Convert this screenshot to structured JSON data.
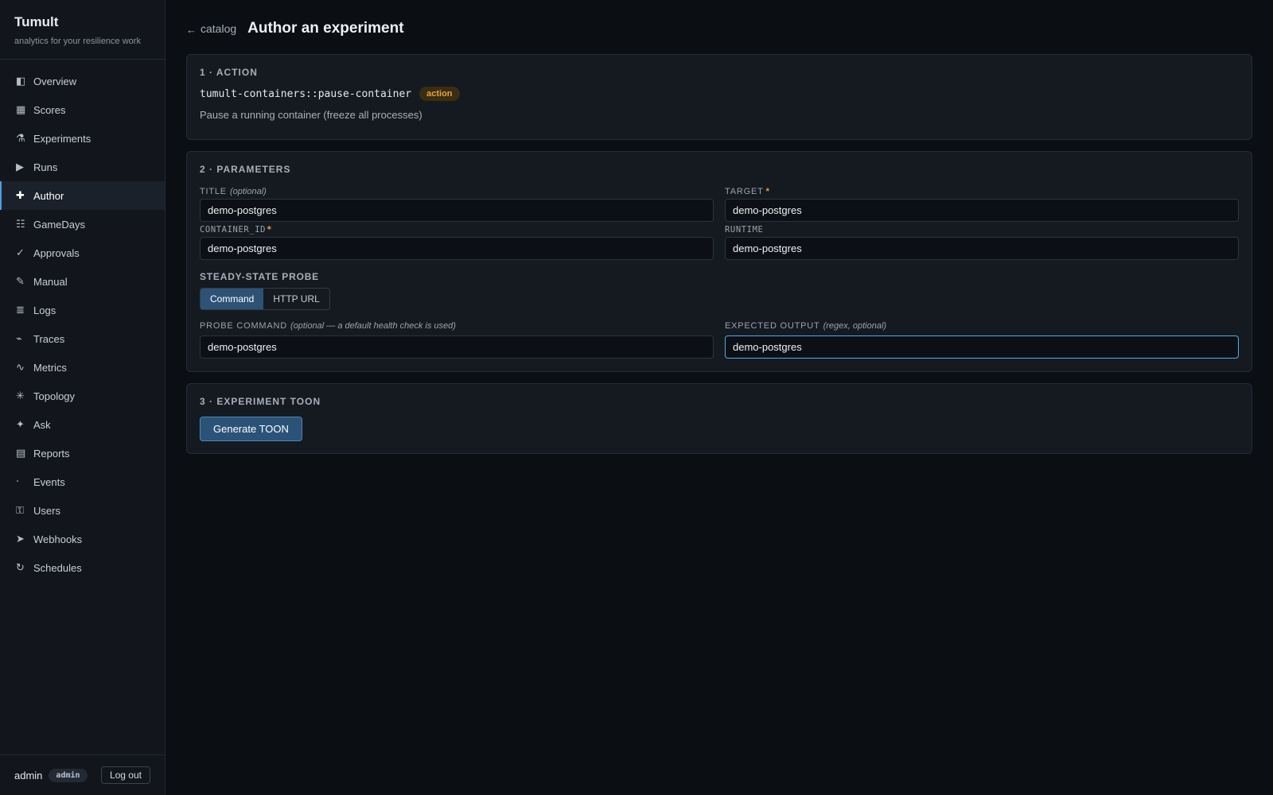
{
  "brand": {
    "title": "Tumult",
    "subtitle": "analytics for your resilience work"
  },
  "sidebar": {
    "items": [
      {
        "label": "Overview",
        "icon": "◧",
        "active": false
      },
      {
        "label": "Scores",
        "icon": "▦",
        "active": false
      },
      {
        "label": "Experiments",
        "icon": "⚗",
        "active": false
      },
      {
        "label": "Runs",
        "icon": "▶",
        "active": false
      },
      {
        "label": "Author",
        "icon": "✚",
        "active": true
      },
      {
        "label": "GameDays",
        "icon": "☷",
        "active": false
      },
      {
        "label": "Approvals",
        "icon": "✓",
        "active": false
      },
      {
        "label": "Manual",
        "icon": "✎",
        "active": false
      },
      {
        "label": "Logs",
        "icon": "≣",
        "active": false
      },
      {
        "label": "Traces",
        "icon": "⌁",
        "active": false
      },
      {
        "label": "Metrics",
        "icon": "∿",
        "active": false
      },
      {
        "label": "Topology",
        "icon": "✳",
        "active": false
      },
      {
        "label": "Ask",
        "icon": "✦",
        "active": false
      },
      {
        "label": "Reports",
        "icon": "▤",
        "active": false
      },
      {
        "label": "Events",
        "icon": "‧",
        "active": false
      },
      {
        "label": "Users",
        "icon": "⚿",
        "active": false
      },
      {
        "label": "Webhooks",
        "icon": "➤",
        "active": false
      },
      {
        "label": "Schedules",
        "icon": "↻",
        "active": false
      }
    ],
    "footer": {
      "user": "admin",
      "role": "admin",
      "logout_label": "Log out"
    }
  },
  "header": {
    "back_arrow": "←",
    "back_label": "catalog",
    "title": "Author an experiment"
  },
  "action_card": {
    "title": "1 · ACTION",
    "action_id": "tumult-containers::pause-container",
    "badge": "action",
    "description": "Pause a running container (freeze all processes)"
  },
  "params_card": {
    "title": "2 · PARAMETERS",
    "fields": {
      "title": {
        "label": "TITLE",
        "hint": "(optional)",
        "value": "demo-postgres"
      },
      "target": {
        "label": "TARGET",
        "required_mark": "*",
        "value": "demo-postgres"
      },
      "container_id": {
        "label": "CONTAINER_ID",
        "required_mark": "*",
        "value": "demo-postgres"
      },
      "runtime": {
        "label": "RUNTIME",
        "value": "demo-postgres"
      }
    },
    "probe": {
      "section_label": "STEADY-STATE PROBE",
      "tabs": [
        "Command",
        "HTTP URL"
      ],
      "active_tab": "Command",
      "probe_command": {
        "label": "PROBE COMMAND",
        "hint": "(optional — a default health check is used)",
        "value": "demo-postgres"
      },
      "expected_output": {
        "label": "EXPECTED OUTPUT",
        "hint": "(regex, optional)",
        "value": "demo-postgres"
      }
    }
  },
  "toon_card": {
    "title": "3 · EXPERIMENT TOON",
    "button_label": "Generate TOON"
  },
  "colors": {
    "accent": "#4d9de0",
    "badge_orange": "#e8a23a",
    "background": "#0b0e12",
    "card": "#151a21"
  }
}
